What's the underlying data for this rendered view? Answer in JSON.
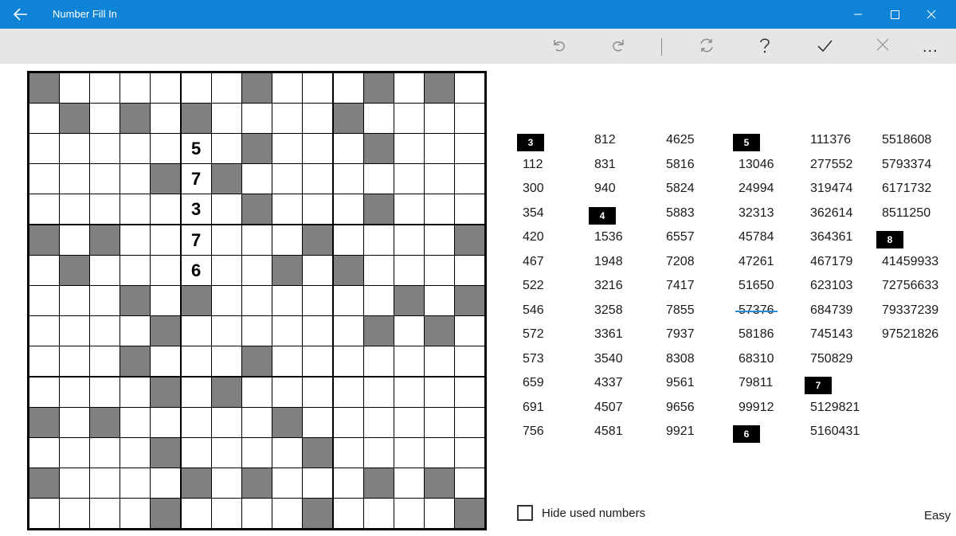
{
  "app": {
    "title": "Number Fill In"
  },
  "toolbar": {
    "more_label": "..."
  },
  "grid": {
    "size": 15,
    "black_cells": [
      [
        0,
        0
      ],
      [
        0,
        7
      ],
      [
        0,
        11
      ],
      [
        0,
        13
      ],
      [
        1,
        1
      ],
      [
        1,
        3
      ],
      [
        1,
        5
      ],
      [
        1,
        10
      ],
      [
        2,
        7
      ],
      [
        2,
        11
      ],
      [
        3,
        4
      ],
      [
        3,
        6
      ],
      [
        4,
        7
      ],
      [
        4,
        11
      ],
      [
        5,
        0
      ],
      [
        5,
        2
      ],
      [
        5,
        9
      ],
      [
        5,
        14
      ],
      [
        6,
        1
      ],
      [
        6,
        8
      ],
      [
        6,
        10
      ],
      [
        7,
        3
      ],
      [
        7,
        5
      ],
      [
        7,
        12
      ],
      [
        7,
        14
      ],
      [
        8,
        4
      ],
      [
        8,
        11
      ],
      [
        8,
        13
      ],
      [
        9,
        3
      ],
      [
        9,
        7
      ],
      [
        10,
        4
      ],
      [
        10,
        6
      ],
      [
        11,
        0
      ],
      [
        11,
        2
      ],
      [
        11,
        8
      ],
      [
        12,
        4
      ],
      [
        12,
        9
      ],
      [
        13,
        0
      ],
      [
        13,
        5
      ],
      [
        13,
        7
      ],
      [
        13,
        11
      ],
      [
        13,
        13
      ],
      [
        14,
        4
      ],
      [
        14,
        9
      ],
      [
        14,
        14
      ]
    ],
    "filled": [
      {
        "row": 2,
        "col": 5,
        "value": "5"
      },
      {
        "row": 3,
        "col": 5,
        "value": "7"
      },
      {
        "row": 4,
        "col": 5,
        "value": "3"
      },
      {
        "row": 5,
        "col": 5,
        "value": "7"
      },
      {
        "row": 6,
        "col": 5,
        "value": "6"
      }
    ]
  },
  "number_list": [
    {
      "type": "header",
      "label": "3",
      "col": 0,
      "row": 0
    },
    {
      "type": "num",
      "value": "112",
      "col": 0,
      "row": 1
    },
    {
      "type": "num",
      "value": "300",
      "col": 0,
      "row": 2
    },
    {
      "type": "num",
      "value": "354",
      "col": 0,
      "row": 3
    },
    {
      "type": "num",
      "value": "420",
      "col": 0,
      "row": 4
    },
    {
      "type": "num",
      "value": "467",
      "col": 0,
      "row": 5
    },
    {
      "type": "num",
      "value": "522",
      "col": 0,
      "row": 6
    },
    {
      "type": "num",
      "value": "546",
      "col": 0,
      "row": 7
    },
    {
      "type": "num",
      "value": "572",
      "col": 0,
      "row": 8
    },
    {
      "type": "num",
      "value": "573",
      "col": 0,
      "row": 9
    },
    {
      "type": "num",
      "value": "659",
      "col": 0,
      "row": 10
    },
    {
      "type": "num",
      "value": "691",
      "col": 0,
      "row": 11
    },
    {
      "type": "num",
      "value": "756",
      "col": 0,
      "row": 12
    },
    {
      "type": "num",
      "value": "812",
      "col": 1,
      "row": 0
    },
    {
      "type": "num",
      "value": "831",
      "col": 1,
      "row": 1
    },
    {
      "type": "num",
      "value": "940",
      "col": 1,
      "row": 2
    },
    {
      "type": "header",
      "label": "4",
      "col": 1,
      "row": 3
    },
    {
      "type": "num",
      "value": "1536",
      "col": 1,
      "row": 4
    },
    {
      "type": "num",
      "value": "1948",
      "col": 1,
      "row": 5
    },
    {
      "type": "num",
      "value": "3216",
      "col": 1,
      "row": 6
    },
    {
      "type": "num",
      "value": "3258",
      "col": 1,
      "row": 7
    },
    {
      "type": "num",
      "value": "3361",
      "col": 1,
      "row": 8
    },
    {
      "type": "num",
      "value": "3540",
      "col": 1,
      "row": 9
    },
    {
      "type": "num",
      "value": "4337",
      "col": 1,
      "row": 10
    },
    {
      "type": "num",
      "value": "4507",
      "col": 1,
      "row": 11
    },
    {
      "type": "num",
      "value": "4581",
      "col": 1,
      "row": 12
    },
    {
      "type": "num",
      "value": "4625",
      "col": 2,
      "row": 0
    },
    {
      "type": "num",
      "value": "5816",
      "col": 2,
      "row": 1
    },
    {
      "type": "num",
      "value": "5824",
      "col": 2,
      "row": 2
    },
    {
      "type": "num",
      "value": "5883",
      "col": 2,
      "row": 3
    },
    {
      "type": "num",
      "value": "6557",
      "col": 2,
      "row": 4
    },
    {
      "type": "num",
      "value": "7208",
      "col": 2,
      "row": 5
    },
    {
      "type": "num",
      "value": "7417",
      "col": 2,
      "row": 6
    },
    {
      "type": "num",
      "value": "7855",
      "col": 2,
      "row": 7
    },
    {
      "type": "num",
      "value": "7937",
      "col": 2,
      "row": 8
    },
    {
      "type": "num",
      "value": "8308",
      "col": 2,
      "row": 9
    },
    {
      "type": "num",
      "value": "9561",
      "col": 2,
      "row": 10
    },
    {
      "type": "num",
      "value": "9656",
      "col": 2,
      "row": 11
    },
    {
      "type": "num",
      "value": "9921",
      "col": 2,
      "row": 12
    },
    {
      "type": "header",
      "label": "5",
      "col": 3,
      "row": 0
    },
    {
      "type": "num",
      "value": "13046",
      "col": 3,
      "row": 1
    },
    {
      "type": "num",
      "value": "24994",
      "col": 3,
      "row": 2
    },
    {
      "type": "num",
      "value": "32313",
      "col": 3,
      "row": 3
    },
    {
      "type": "num",
      "value": "45784",
      "col": 3,
      "row": 4
    },
    {
      "type": "num",
      "value": "47261",
      "col": 3,
      "row": 5
    },
    {
      "type": "num",
      "value": "51650",
      "col": 3,
      "row": 6
    },
    {
      "type": "num",
      "value": "57376",
      "col": 3,
      "row": 7,
      "used": true
    },
    {
      "type": "num",
      "value": "58186",
      "col": 3,
      "row": 8
    },
    {
      "type": "num",
      "value": "68310",
      "col": 3,
      "row": 9
    },
    {
      "type": "num",
      "value": "79811",
      "col": 3,
      "row": 10
    },
    {
      "type": "num",
      "value": "99912",
      "col": 3,
      "row": 11
    },
    {
      "type": "header",
      "label": "6",
      "col": 3,
      "row": 12
    },
    {
      "type": "num",
      "value": "111376",
      "col": 4,
      "row": 0
    },
    {
      "type": "num",
      "value": "277552",
      "col": 4,
      "row": 1
    },
    {
      "type": "num",
      "value": "319474",
      "col": 4,
      "row": 2
    },
    {
      "type": "num",
      "value": "362614",
      "col": 4,
      "row": 3
    },
    {
      "type": "num",
      "value": "364361",
      "col": 4,
      "row": 4
    },
    {
      "type": "num",
      "value": "467179",
      "col": 4,
      "row": 5
    },
    {
      "type": "num",
      "value": "623103",
      "col": 4,
      "row": 6
    },
    {
      "type": "num",
      "value": "684739",
      "col": 4,
      "row": 7
    },
    {
      "type": "num",
      "value": "745143",
      "col": 4,
      "row": 8
    },
    {
      "type": "num",
      "value": "750829",
      "col": 4,
      "row": 9
    },
    {
      "type": "header",
      "label": "7",
      "col": 4,
      "row": 10
    },
    {
      "type": "num",
      "value": "5129821",
      "col": 4,
      "row": 11
    },
    {
      "type": "num",
      "value": "5160431",
      "col": 4,
      "row": 12
    },
    {
      "type": "num",
      "value": "5518608",
      "col": 5,
      "row": 0
    },
    {
      "type": "num",
      "value": "5793374",
      "col": 5,
      "row": 1
    },
    {
      "type": "num",
      "value": "6171732",
      "col": 5,
      "row": 2
    },
    {
      "type": "num",
      "value": "8511250",
      "col": 5,
      "row": 3
    },
    {
      "type": "header",
      "label": "8",
      "col": 5,
      "row": 4
    },
    {
      "type": "num",
      "value": "41459933",
      "col": 5,
      "row": 5
    },
    {
      "type": "num",
      "value": "72756633",
      "col": 5,
      "row": 6
    },
    {
      "type": "num",
      "value": "79337239",
      "col": 5,
      "row": 7
    },
    {
      "type": "num",
      "value": "97521826",
      "col": 5,
      "row": 8
    }
  ],
  "footer": {
    "hide_used_label": "Hide used numbers",
    "hide_used_checked": false,
    "difficulty": "Easy"
  },
  "colors": {
    "titlebar": "#0f84d6",
    "toolbar": "#e6e6e6",
    "black_cell": "#808080",
    "strike": "#2a8ad4"
  }
}
